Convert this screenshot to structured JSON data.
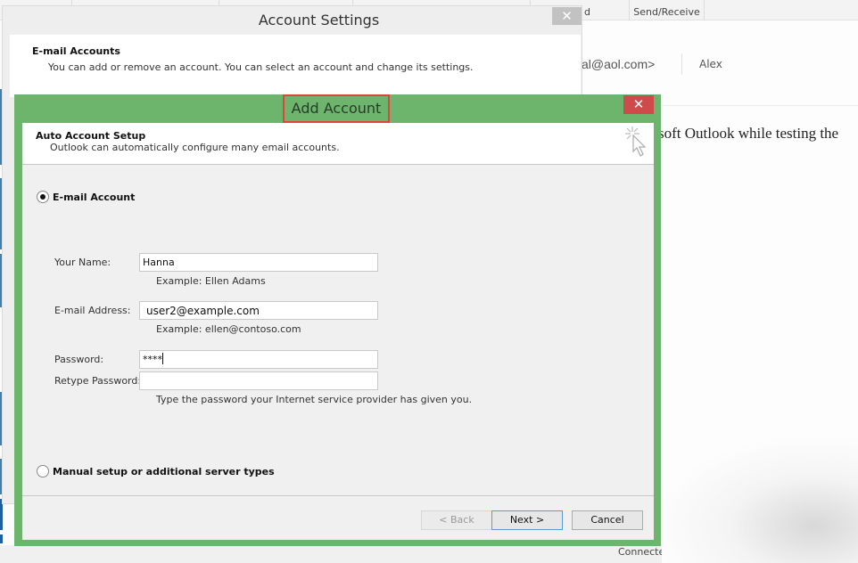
{
  "background_app": {
    "ribbon_tabs": [
      "",
      "",
      "",
      "d",
      "Send/Receive"
    ],
    "sender_email_fragment": "al@aol.com>",
    "recipient": "Alex",
    "body_fragment": "soft Outlook while testing the",
    "status_text": "Connectec"
  },
  "account_settings": {
    "title": "Account Settings",
    "close_label": "✕",
    "heading": "E-mail Accounts",
    "description": "You can add or remove an account. You can select an account and change its settings."
  },
  "add_account": {
    "title": "Add Account",
    "close_label": "✕",
    "header_title": "Auto Account Setup",
    "header_desc": "Outlook can automatically configure many email accounts.",
    "options": [
      {
        "label": "E-mail Account",
        "selected": true
      },
      {
        "label": "Manual setup or additional server types",
        "selected": false
      }
    ],
    "fields": {
      "name": {
        "label": "Your Name:",
        "value": "Hanna",
        "hint": "Example: Ellen Adams"
      },
      "email": {
        "label": "E-mail Address:",
        "value": "user2@example.com",
        "hint": "Example: ellen@contoso.com"
      },
      "password": {
        "label": "Password:",
        "value": "****"
      },
      "retype": {
        "label": "Retype Password:",
        "value": "",
        "hint": "Type the password your Internet service provider has given you."
      }
    },
    "buttons": {
      "back": "< Back",
      "next": "Next >",
      "cancel": "Cancel"
    },
    "colors": {
      "frame": "#6db46d",
      "highlight": "#e0453a",
      "close": "#cf4b4b"
    }
  }
}
